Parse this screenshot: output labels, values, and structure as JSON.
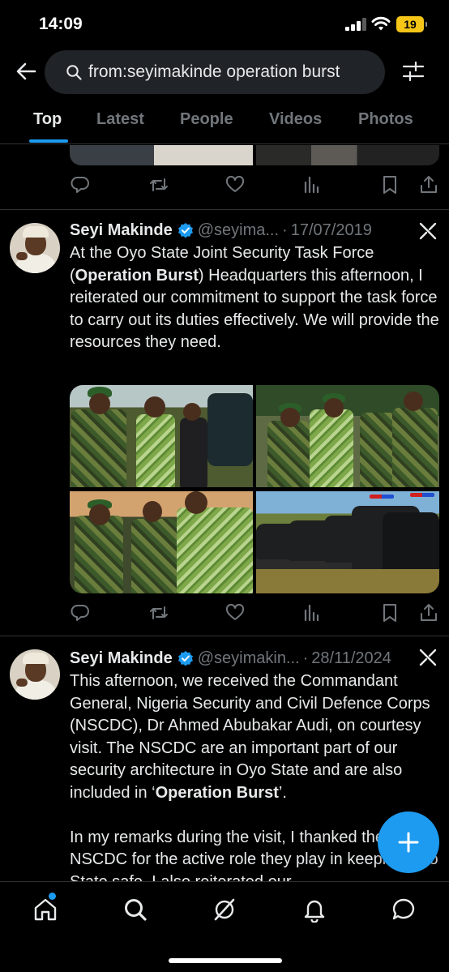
{
  "status_bar": {
    "time": "14:09",
    "battery": "19"
  },
  "search": {
    "query": "from:seyimakinde operation burst"
  },
  "tabs": [
    {
      "label": "Top",
      "active": true
    },
    {
      "label": "Latest"
    },
    {
      "label": "People"
    },
    {
      "label": "Videos"
    },
    {
      "label": "Photos"
    }
  ],
  "tweets": [
    {
      "name": "Seyi Makinde",
      "handle": "@seyima...",
      "separator": "·",
      "date": "17/07/2019",
      "text_parts": [
        "At the Oyo State Joint Security Task Force (",
        "Operation Burst",
        ") Headquarters this afternoon, I reiterated our commitment to support the task force to carry out its duties effectively. We will provide the resources they need."
      ]
    },
    {
      "name": "Seyi Makinde",
      "handle": "@seyimakin...",
      "separator": "·",
      "date": "28/11/2024",
      "text_parts": [
        "This afternoon, we received the Commandant General, Nigeria Security and Civil Defence Corps (NSCDC), Dr Ahmed Abubakar Audi, on courtesy visit. The NSCDC are an important part of our security architecture in Oyo State and are also included in ‘",
        "Operation Burst",
        "’.",
        "In my remarks during the visit, I thanked the NSCDC for the active role they play in keeping Oyo State safe. I also reiterated our"
      ]
    }
  ],
  "colors": {
    "accent": "#1d9bf0",
    "background": "#000000",
    "secondary_text": "#71767b",
    "divider": "#2f3336"
  }
}
